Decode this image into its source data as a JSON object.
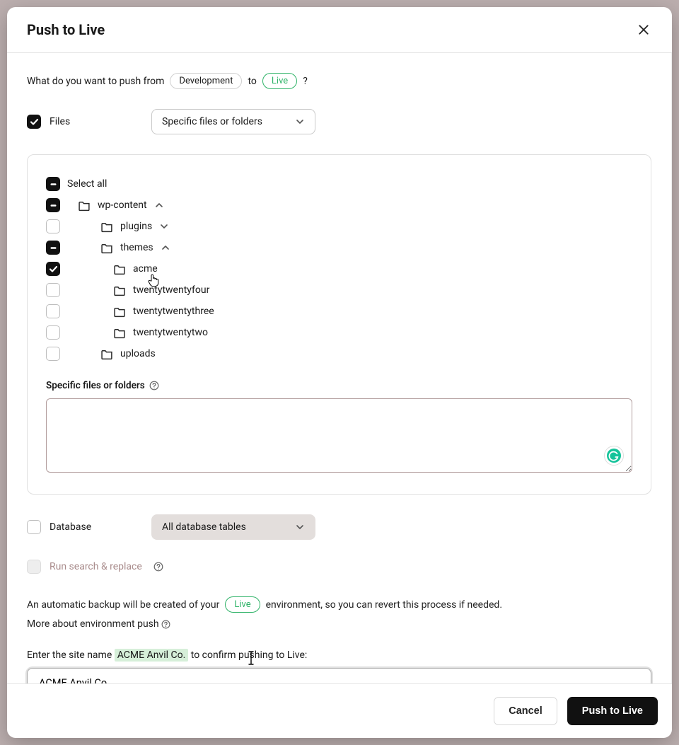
{
  "modal": {
    "title": "Push to Live",
    "question_prefix": "What do you want to push from",
    "from_env": "Development",
    "to_word": "to",
    "to_env": "Live",
    "question_suffix": "?"
  },
  "files": {
    "label": "Files",
    "select_value": "Specific files or folders",
    "tree": {
      "select_all": "Select all",
      "wp_content": "wp-content",
      "plugins": "plugins",
      "themes": "themes",
      "acme": "acme",
      "twentytwentyfour": "twentytwentyfour",
      "twentytwentythree": "twentytwentythree",
      "twentytwentytwo": "twentytwentytwo",
      "uploads": "uploads"
    },
    "specific_label": "Specific files or folders",
    "textarea_value": ""
  },
  "database": {
    "label": "Database",
    "select_value": "All database tables"
  },
  "search_replace": {
    "label": "Run search & replace"
  },
  "backup": {
    "pre": "An automatic backup will be created of your",
    "env": "Live",
    "post": "environment, so you can revert this process if needed.",
    "more": "More about environment push"
  },
  "confirm": {
    "pre": "Enter the site name",
    "site": "ACME Anvil Co.",
    "post": "to confirm pushing to Live:",
    "value": "ACME Anvil Co."
  },
  "footer": {
    "cancel": "Cancel",
    "push": "Push to Live"
  }
}
